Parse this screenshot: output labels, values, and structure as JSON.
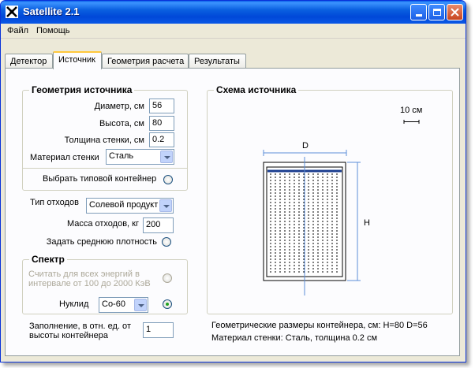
{
  "window": {
    "title": "Satellite 2.1"
  },
  "menu": {
    "file": "Файл",
    "help": "Помощь"
  },
  "tabs": [
    {
      "label": "Детектор",
      "active": false
    },
    {
      "label": "Источник",
      "active": true
    },
    {
      "label": "Геометрия расчета",
      "active": false
    },
    {
      "label": "Результаты",
      "active": false
    }
  ],
  "source_geometry": {
    "title": "Геометрия источника",
    "diameter_label": "Диаметр, см",
    "diameter_value": "56",
    "height_label": "Высота, см",
    "height_value": "80",
    "wall_label": "Толщина стенки, см",
    "wall_value": "0.2",
    "material_label": "Материал стенки",
    "material_value": "Сталь",
    "container_label": "Выбрать типовой контейнер"
  },
  "waste": {
    "type_label": "Тип отходов",
    "type_value": "Солевой продукт",
    "mass_label": "Масса отходов, кг",
    "mass_value": "200",
    "density_label": "Задать среднюю плотность"
  },
  "spectrum": {
    "title": "Спектр",
    "all_energies_line1": "Считать для всех энергий в",
    "all_energies_line2": "интервале от 100 до 2000 КэВ",
    "nuclide_label": "Нуклид",
    "nuclide_value": "Co-60"
  },
  "fill": {
    "label_line1": "Заполнение, в отн. ед. от",
    "label_line2": "высоты контейнера",
    "value": "1"
  },
  "schema": {
    "title": "Схема источника",
    "scale_label": "10 см",
    "d_label": "D",
    "h_label": "H",
    "info_line1": "Геометрические размеры контейнера, см:  H=80    D=56",
    "info_line2": "Материал стенки:    Сталь,      толщина 0.2 см"
  },
  "colors": {
    "titlebar": "#0a5fe0",
    "accent": "#ffc83c",
    "fill_line": "#1a3d8f",
    "axis": "#5b8ed8"
  }
}
